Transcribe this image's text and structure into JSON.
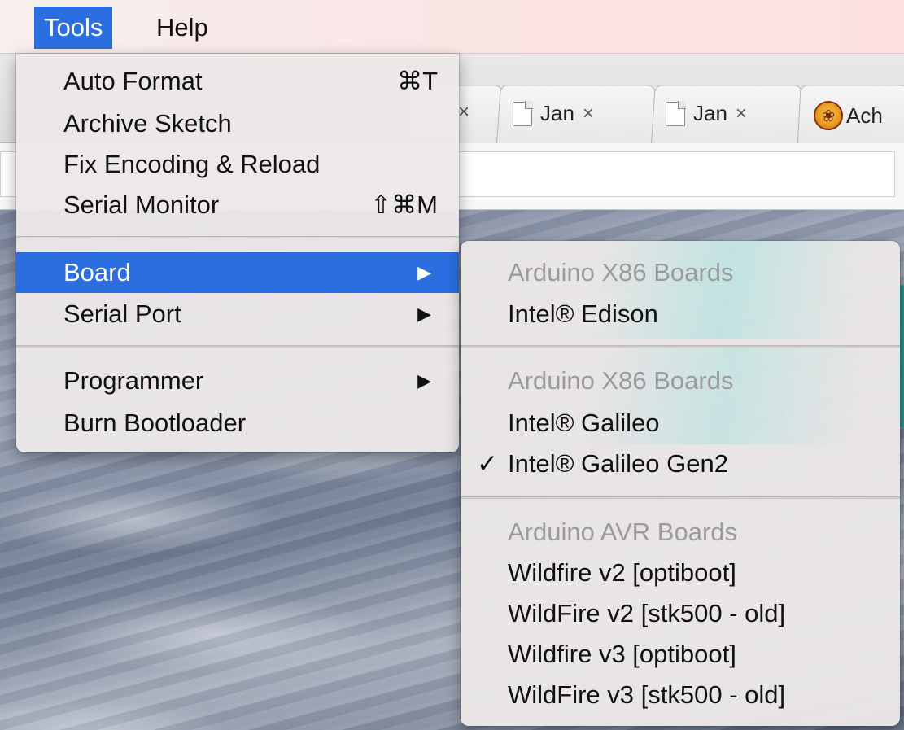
{
  "menubar": {
    "items": [
      "Tools",
      "Help"
    ],
    "active": "Tools"
  },
  "browser": {
    "tabs": [
      {
        "title": "Jan",
        "close": "×",
        "icon": "document-icon"
      },
      {
        "title": "Jan",
        "close": "×",
        "icon": "document-icon"
      },
      {
        "title": "Ach",
        "icon": "tree-logo-icon"
      }
    ],
    "partial_close_glyph": "×"
  },
  "tools_menu": {
    "items": [
      {
        "label": "Auto Format",
        "shortcut": "⌘T"
      },
      {
        "label": "Archive Sketch"
      },
      {
        "label": "Fix Encoding & Reload"
      },
      {
        "label": "Serial Monitor",
        "shortcut": "⇧⌘M"
      },
      {
        "label": "Board",
        "submenu_arrow": "▶",
        "highlighted": true
      },
      {
        "label": "Serial Port",
        "submenu_arrow": "▶"
      },
      {
        "label": "Programmer",
        "submenu_arrow": "▶"
      },
      {
        "label": "Burn Bootloader"
      }
    ]
  },
  "board_submenu": {
    "groups": [
      {
        "header": "Arduino X86 Boards",
        "items": [
          "Intel® Edison"
        ]
      },
      {
        "header": "Arduino X86 Boards",
        "items": [
          "Intel® Galileo",
          "Intel® Galileo Gen2"
        ]
      },
      {
        "header": "Arduino AVR Boards",
        "items": [
          "Wildfire v2 [optiboot]",
          "WildFire v2 [stk500 - old]",
          "Wildfire v3 [optiboot]",
          "WildFire v3 [stk500 - old]"
        ]
      }
    ],
    "selected": "Intel® Galileo Gen2",
    "check_mark": "✓"
  },
  "colors": {
    "highlight": "#2a6ee0",
    "menu_background": "#ece8e8",
    "section_header_text": "#9b9b9b"
  }
}
